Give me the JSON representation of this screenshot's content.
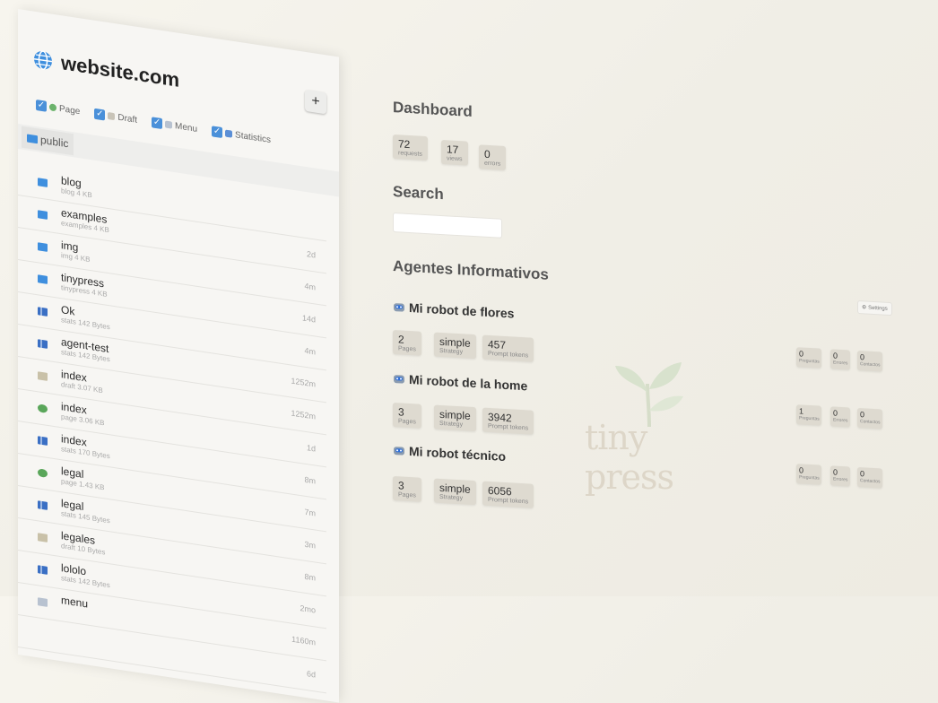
{
  "sidebar": {
    "site_title": "website.com",
    "add_label": "+",
    "filters": [
      {
        "label": "Page",
        "checked": true
      },
      {
        "label": "Draft",
        "checked": true
      },
      {
        "label": "Menu",
        "checked": true
      },
      {
        "label": "Statistics",
        "checked": true
      }
    ],
    "path": "public",
    "files": [
      {
        "name": "blog",
        "meta": "blog 4 KB",
        "time": "",
        "icon": "folder-icon"
      },
      {
        "name": "examples",
        "meta": "examples 4 KB",
        "time": "2d",
        "icon": "folder-icon"
      },
      {
        "name": "img",
        "meta": "img 4 KB",
        "time": "4m",
        "icon": "folder-icon"
      },
      {
        "name": "tinypress",
        "meta": "tinypress 4 KB",
        "time": "14d",
        "icon": "folder-icon"
      },
      {
        "name": "Ok",
        "meta": "stats 142 Bytes",
        "time": "4m",
        "icon": "stats-icon"
      },
      {
        "name": "agent-test",
        "meta": "stats 142 Bytes",
        "time": "1252m",
        "icon": "stats-icon"
      },
      {
        "name": "index",
        "meta": "draft 3.07 KB",
        "time": "1252m",
        "icon": "draft-icon"
      },
      {
        "name": "index",
        "meta": "page 3.06 KB",
        "time": "1d",
        "icon": "page-icon"
      },
      {
        "name": "index",
        "meta": "stats 170 Bytes",
        "time": "8m",
        "icon": "stats-icon"
      },
      {
        "name": "legal",
        "meta": "page 1.43 KB",
        "time": "7m",
        "icon": "page-icon"
      },
      {
        "name": "legal",
        "meta": "stats 145 Bytes",
        "time": "3m",
        "icon": "stats-icon"
      },
      {
        "name": "legales",
        "meta": "draft 10 Bytes",
        "time": "8m",
        "icon": "draft-icon"
      },
      {
        "name": "lololo",
        "meta": "stats 142 Bytes",
        "time": "2mo",
        "icon": "stats-icon"
      },
      {
        "name": "menu",
        "meta": "",
        "time": "1160m",
        "icon": "menu-icon"
      }
    ],
    "extra_time": "6d"
  },
  "dashboard": {
    "title": "Dashboard",
    "stats": [
      {
        "value": "72",
        "label": "requests"
      },
      {
        "value": "17",
        "label": "views"
      },
      {
        "value": "0",
        "label": "errors"
      }
    ]
  },
  "search": {
    "title": "Search",
    "placeholder": ""
  },
  "agents": {
    "title": "Agentes Informativos",
    "settings_label": "Settings",
    "items": [
      {
        "name": "Mi robot de flores",
        "stats": [
          {
            "value": "2",
            "label": "Pages"
          },
          {
            "value": "simple",
            "label": "Strategy"
          },
          {
            "value": "457",
            "label": "Prompt tokens"
          }
        ],
        "side": [
          {
            "value": "0",
            "label": "Preguntas"
          },
          {
            "value": "0",
            "label": "Errores"
          },
          {
            "value": "0",
            "label": "Contactos"
          }
        ]
      },
      {
        "name": "Mi robot de la home",
        "stats": [
          {
            "value": "3",
            "label": "Pages"
          },
          {
            "value": "simple",
            "label": "Strategy"
          },
          {
            "value": "3942",
            "label": "Prompt tokens"
          }
        ],
        "side": [
          {
            "value": "1",
            "label": "Preguntas"
          },
          {
            "value": "0",
            "label": "Errores"
          },
          {
            "value": "0",
            "label": "Contactos"
          }
        ]
      },
      {
        "name": "Mi robot técnico",
        "stats": [
          {
            "value": "3",
            "label": "Pages"
          },
          {
            "value": "simple",
            "label": "Strategy"
          },
          {
            "value": "6056",
            "label": "Prompt tokens"
          }
        ],
        "side": [
          {
            "value": "0",
            "label": "Preguntas"
          },
          {
            "value": "0",
            "label": "Errores"
          },
          {
            "value": "0",
            "label": "Contactos"
          }
        ]
      }
    ]
  },
  "logo": {
    "text": "tiny press",
    "color": "#ddd6c8"
  },
  "colors": {
    "accent": "#4a90d9",
    "folder": "#3f8fde",
    "stat_bg": "#dedad0"
  }
}
